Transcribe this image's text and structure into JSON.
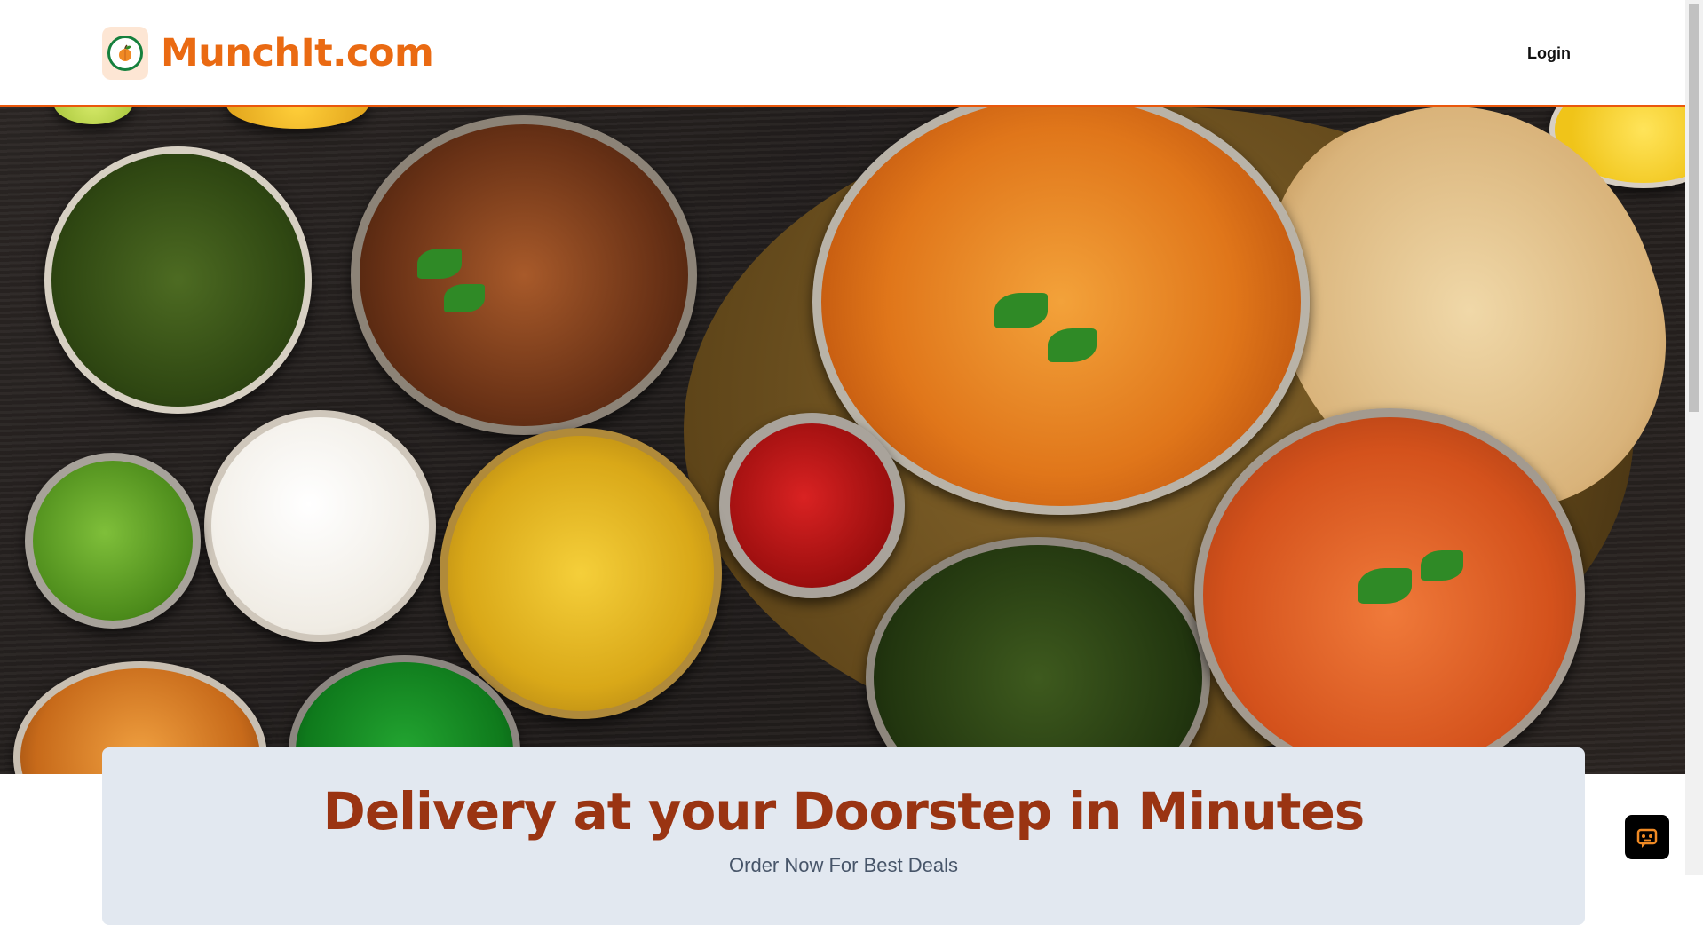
{
  "header": {
    "brand_name": "MunchIt.com",
    "login_label": "Login",
    "logo_icon": "peach-fruit-icon"
  },
  "hero": {
    "image_alt": "spread-of-indian-dishes"
  },
  "promo": {
    "headline": "Delivery at your Doorstep in Minutes",
    "subheadline": "Order Now For Best Deals"
  },
  "chat": {
    "icon": "chatbot-icon"
  },
  "colors": {
    "brand_orange": "#ea6a12",
    "header_border": "#ea580c",
    "headline": "#9a3412",
    "card_bg": "#e2e8f0"
  }
}
